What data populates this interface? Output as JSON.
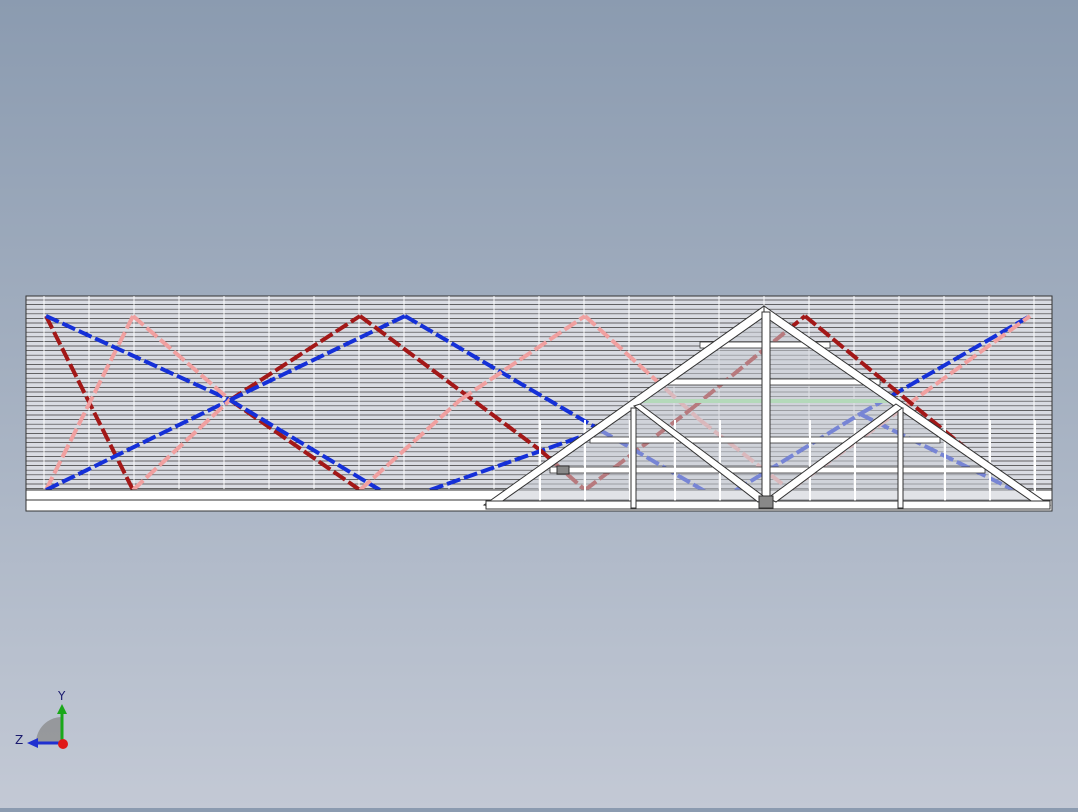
{
  "viewport": {
    "background_top": "#8b9bb0",
    "background_bottom": "#c3c9d5"
  },
  "model": {
    "frame_color": "#ffffff",
    "outline_color": "#2a2a2a",
    "brace_colors": {
      "dark_red": "#a31818",
      "pink": "#f0a0a0",
      "blue": "#1530d8",
      "green": "#9be89b"
    }
  },
  "triad": {
    "y_label": "Y",
    "z_label": "Z",
    "colors": {
      "y": "#1aa81a",
      "z": "#2030d0",
      "x": "#e01818"
    }
  }
}
